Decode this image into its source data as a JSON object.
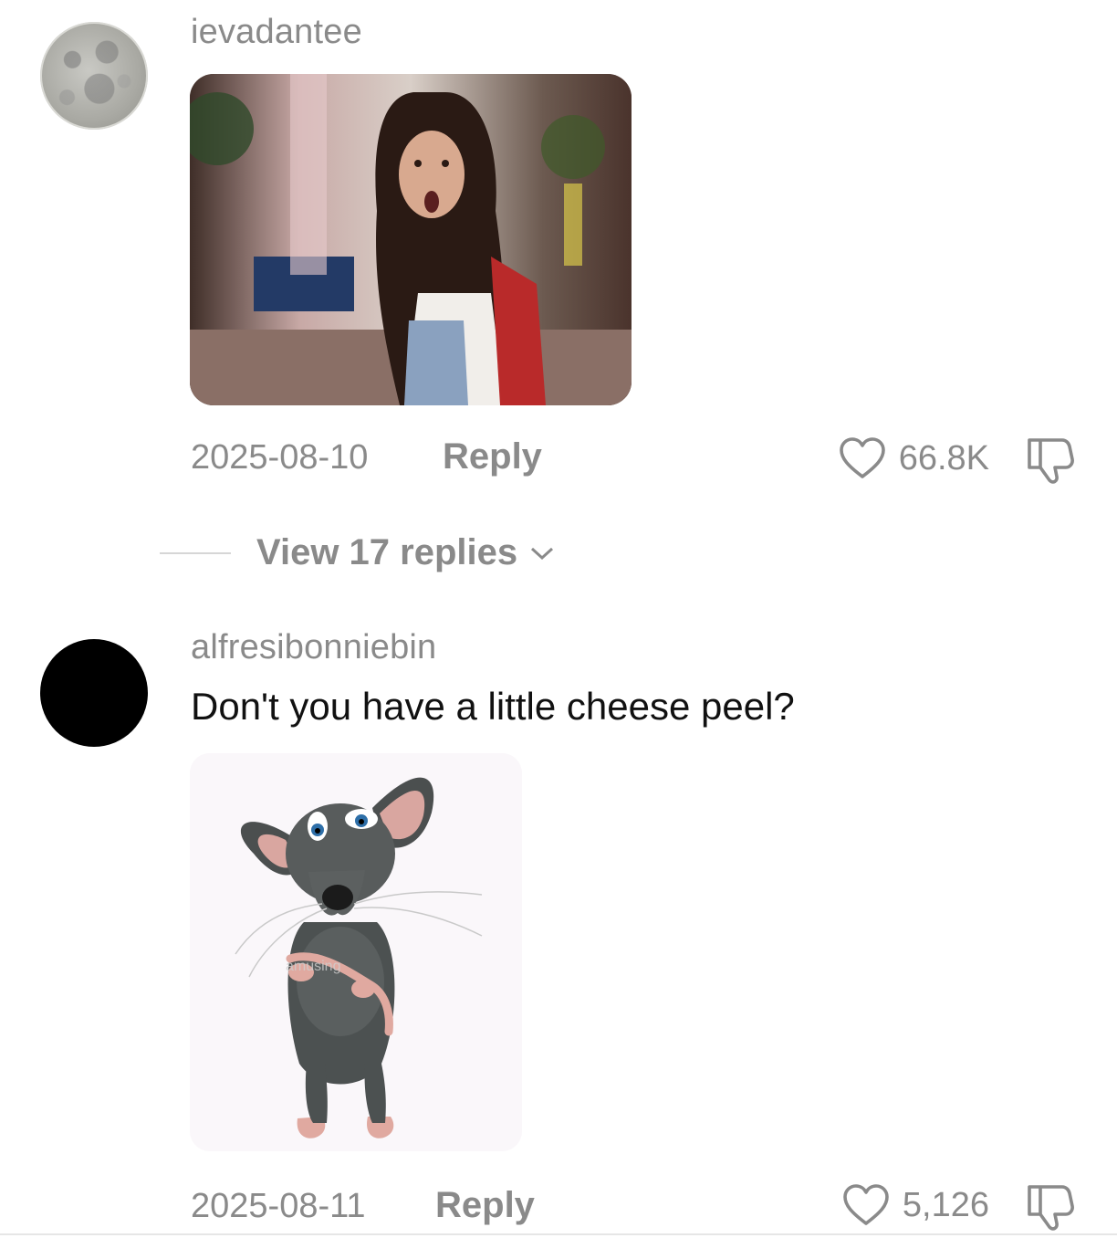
{
  "comments": [
    {
      "username": "ievadantee",
      "date": "2025-08-10",
      "reply_label": "Reply",
      "likes": "66.8K",
      "view_replies": "View 17 replies"
    },
    {
      "username": "alfresibonniebin",
      "text": "Don't you have a little cheese peel?",
      "date": "2025-08-11",
      "reply_label": "Reply",
      "likes": "5,126",
      "watermark": "amusing"
    }
  ]
}
